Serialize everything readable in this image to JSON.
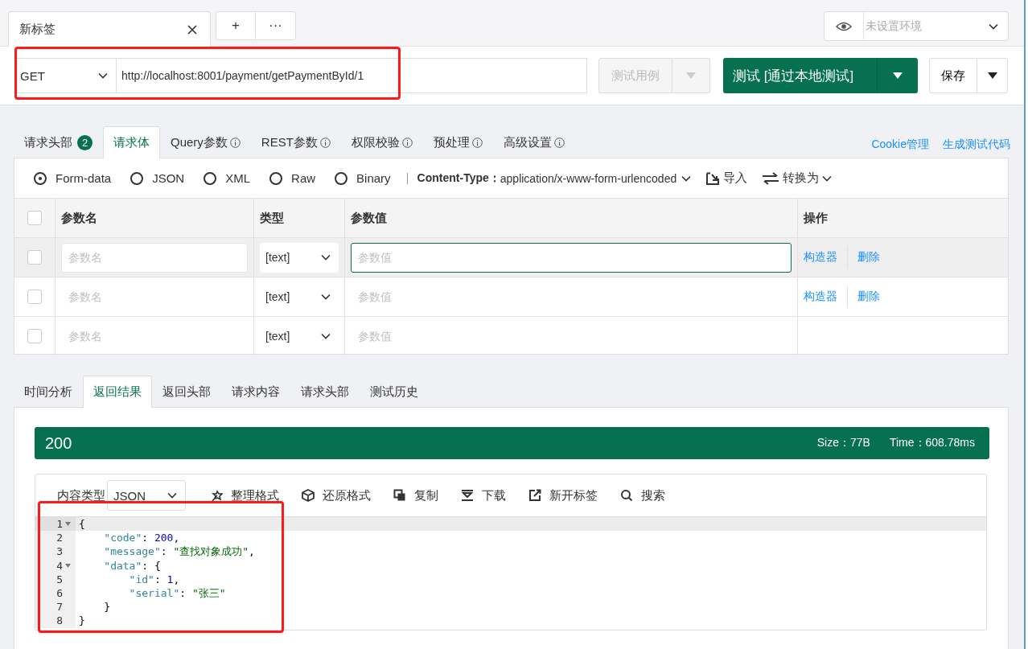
{
  "tab_bar": {
    "tabs": [
      {
        "title": "新标签",
        "selected": true
      }
    ],
    "add_label": "+",
    "more_label": "···"
  },
  "environment": {
    "placeholder": "未设置环境"
  },
  "request": {
    "method": "GET",
    "url": "http://localhost:8001/payment/getPaymentById/1",
    "highlighted": true,
    "test_case_button": {
      "label": "测试用例",
      "disabled": true
    },
    "run_button": {
      "label": "测试 [通过本地测试]"
    },
    "save_button": {
      "label": "保存"
    }
  },
  "request_tabs": [
    {
      "label": "请求头部",
      "selected": false,
      "badge": "2"
    },
    {
      "label": "请求体",
      "selected": true
    },
    {
      "label": "Query参数",
      "selected": false,
      "info": true
    },
    {
      "label": "REST参数",
      "selected": false,
      "info": true
    },
    {
      "label": "权限校验",
      "selected": false,
      "info": true
    },
    {
      "label": "预处理",
      "selected": false,
      "info": true
    },
    {
      "label": "高级设置",
      "selected": false,
      "info": true
    }
  ],
  "request_links": [
    "Cookie管理",
    "生成测试代码"
  ],
  "body": {
    "types": [
      {
        "label": "Form-data",
        "selected": true
      },
      {
        "label": "JSON",
        "selected": false
      },
      {
        "label": "XML",
        "selected": false
      },
      {
        "label": "Raw",
        "selected": false
      },
      {
        "label": "Binary",
        "selected": false
      }
    ],
    "content_type_label": "Content-Type：",
    "content_type": "application/x-www-form-urlencoded",
    "import_label": "导入",
    "convert_label": "转换为"
  },
  "params_table": {
    "all_checked": false,
    "columns": [
      "参数名",
      "类型",
      "参数值",
      "操作"
    ],
    "rows": [
      {
        "checked": false,
        "active": true,
        "name_placeholder": "参数名",
        "type": "[text]",
        "value_placeholder": "参数值",
        "value_focused": true,
        "actions": [
          "构造器",
          "删除"
        ]
      },
      {
        "checked": false,
        "active": false,
        "name_placeholder": "参数名",
        "type": "[text]",
        "value_placeholder": "参数值",
        "value_focused": false,
        "actions": [
          "构造器",
          "删除"
        ]
      },
      {
        "checked": false,
        "active": false,
        "name_placeholder": "参数名",
        "type": "[text]",
        "value_placeholder": "参数值",
        "value_focused": false
      }
    ]
  },
  "response_tabs": [
    {
      "label": "时间分析",
      "selected": false
    },
    {
      "label": "返回结果",
      "selected": true
    },
    {
      "label": "返回头部",
      "selected": false
    },
    {
      "label": "请求内容",
      "selected": false
    },
    {
      "label": "请求头部",
      "selected": false
    },
    {
      "label": "测试历史",
      "selected": false
    }
  ],
  "response": {
    "status": "200",
    "size": "Size：77B",
    "time": "Time：608.78ms",
    "content_type_label": "内容类型",
    "content_type": "JSON",
    "tools": [
      "整理格式",
      "还原格式",
      "复制",
      "下载",
      "新开标签",
      "搜索"
    ],
    "highlighted": true,
    "lines": [
      {
        "number": "1",
        "fold": true,
        "active": true,
        "tokens": [
          {
            "kind": "punct",
            "text": "{"
          }
        ]
      },
      {
        "number": "2",
        "fold": false,
        "active": false,
        "tokens": [
          {
            "kind": "key",
            "text": "    \"code\""
          },
          {
            "kind": "punct",
            "text": ": "
          },
          {
            "kind": "num",
            "text": "200"
          },
          {
            "kind": "punct",
            "text": ","
          }
        ]
      },
      {
        "number": "3",
        "fold": false,
        "active": false,
        "tokens": [
          {
            "kind": "key",
            "text": "    \"message\""
          },
          {
            "kind": "punct",
            "text": ": "
          },
          {
            "kind": "str",
            "text": "\"查找对象成功\""
          },
          {
            "kind": "punct",
            "text": ","
          }
        ]
      },
      {
        "number": "4",
        "fold": true,
        "active": false,
        "tokens": [
          {
            "kind": "key",
            "text": "    \"data\""
          },
          {
            "kind": "punct",
            "text": ": {"
          }
        ]
      },
      {
        "number": "5",
        "fold": false,
        "active": false,
        "tokens": [
          {
            "kind": "key",
            "text": "        \"id\""
          },
          {
            "kind": "punct",
            "text": ": "
          },
          {
            "kind": "num",
            "text": "1"
          },
          {
            "kind": "punct",
            "text": ","
          }
        ]
      },
      {
        "number": "6",
        "fold": false,
        "active": false,
        "tokens": [
          {
            "kind": "key",
            "text": "        \"serial\""
          },
          {
            "kind": "punct",
            "text": ": "
          },
          {
            "kind": "str",
            "text": "\"张三\""
          }
        ]
      },
      {
        "number": "7",
        "fold": false,
        "active": false,
        "tokens": [
          {
            "kind": "punct",
            "text": "    }"
          }
        ]
      },
      {
        "number": "8",
        "fold": false,
        "active": false,
        "tokens": [
          {
            "kind": "punct",
            "text": "}"
          }
        ]
      }
    ]
  }
}
